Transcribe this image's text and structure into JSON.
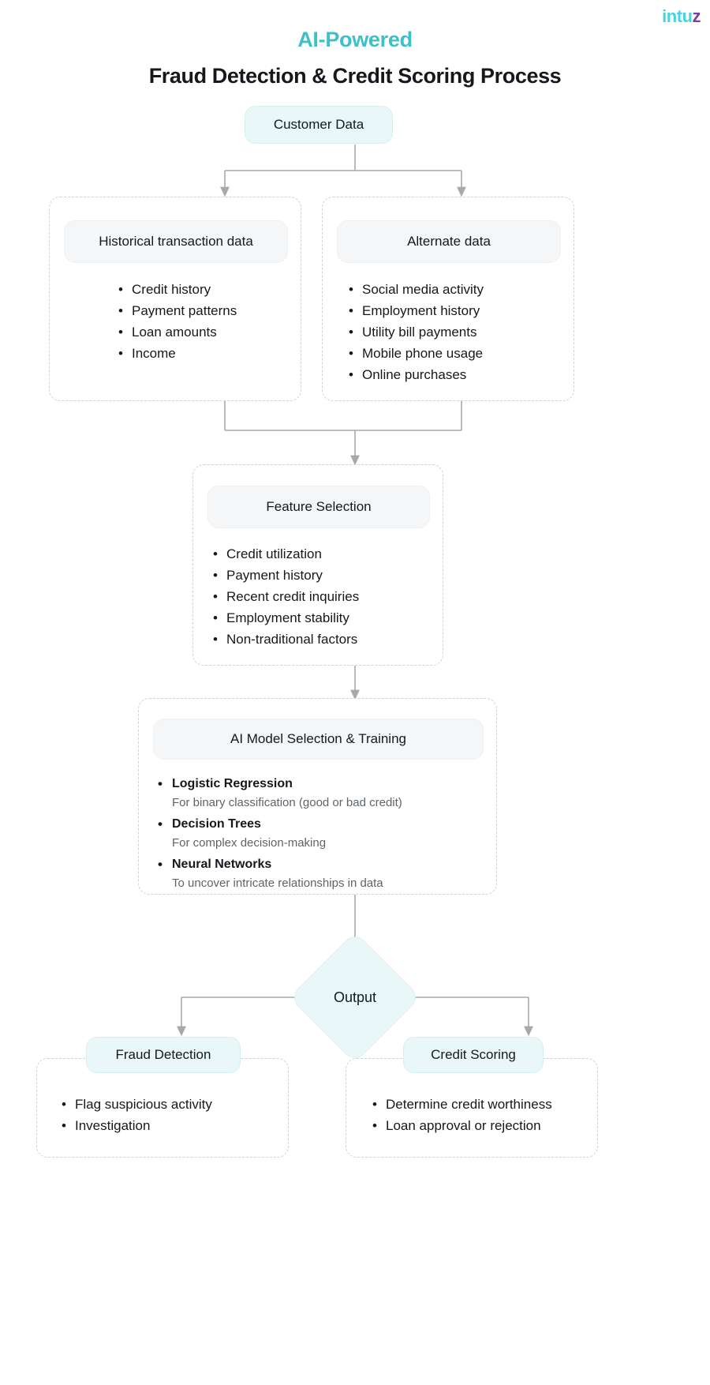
{
  "logo": {
    "part1": "intu",
    "part2": "z"
  },
  "header": {
    "title_accent": "AI-Powered",
    "title_main": "Fraud Detection & Credit Scoring Process"
  },
  "colors": {
    "accent_teal": "#3FC0C8",
    "logo_cyan": "#45D4E0",
    "logo_purple": "#7B3FA0",
    "node_cyan_fill": "#E9F7F9",
    "pill_gray_fill": "#F5F6F7",
    "connector_gray": "#A6AAAD",
    "dash_border": "#CFD2D6",
    "muted_text": "#5E6469"
  },
  "flow": {
    "root": {
      "label": "Customer Data"
    },
    "sources": [
      {
        "header": "Historical transaction data",
        "items": [
          "Credit history",
          "Payment patterns",
          "Loan amounts",
          "Income"
        ]
      },
      {
        "header": "Alternate data",
        "items": [
          "Social media activity",
          "Employment history",
          "Utility bill payments",
          "Mobile phone usage",
          "Online purchases"
        ]
      }
    ],
    "feature_selection": {
      "header": "Feature Selection",
      "items": [
        "Credit utilization",
        "Payment history",
        "Recent credit inquiries",
        "Employment stability",
        "Non-traditional factors"
      ]
    },
    "model_training": {
      "header": "AI Model Selection & Training",
      "items": [
        {
          "title": "Logistic Regression",
          "desc": "For binary classification (good or bad credit)"
        },
        {
          "title": "Decision Trees",
          "desc": "For complex decision-making"
        },
        {
          "title": "Neural Networks",
          "desc": "To uncover intricate relationships in data"
        }
      ]
    },
    "output": {
      "label": "Output"
    },
    "outcomes": [
      {
        "header": "Fraud Detection",
        "items": [
          "Flag suspicious activity",
          "Investigation"
        ]
      },
      {
        "header": "Credit Scoring",
        "items": [
          "Determine credit worthiness",
          "Loan approval or rejection"
        ]
      }
    ]
  }
}
